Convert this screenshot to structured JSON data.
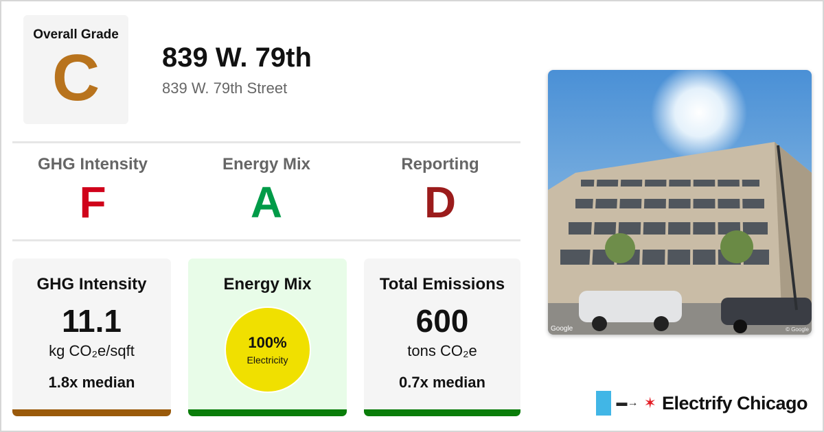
{
  "overall": {
    "label": "Overall Grade",
    "grade": "C",
    "color": "#b8731d"
  },
  "building": {
    "name": "839 W. 79th",
    "address": "839 W. 79th Street"
  },
  "grades": [
    {
      "label": "GHG Intensity",
      "grade": "F",
      "color": "#d0021b"
    },
    {
      "label": "Energy Mix",
      "grade": "A",
      "color": "#009b48"
    },
    {
      "label": "Reporting",
      "grade": "D",
      "color": "#9b1c1c"
    }
  ],
  "cards": {
    "ghg": {
      "title": "GHG Intensity",
      "value": "11.1",
      "unit": "kg CO₂e/sqft",
      "median": "1.8x median",
      "bar_color": "#9a5a0b"
    },
    "mix": {
      "title": "Energy Mix",
      "percent": "100%",
      "fuel": "Electricity",
      "fuel_color": "#f0e000",
      "bg": "#e8fce8",
      "bar_color": "#0a7d0a"
    },
    "emissions": {
      "title": "Total Emissions",
      "value": "600",
      "unit": "tons CO₂e",
      "median": "0.7x median",
      "bar_color": "#0a7d0a"
    }
  },
  "photo": {
    "credit_left": "Google",
    "credit_right": "© Google"
  },
  "brand": {
    "name": "Electrify Chicago",
    "flag_color": "#41b6e6",
    "star_color": "#e31b23"
  }
}
